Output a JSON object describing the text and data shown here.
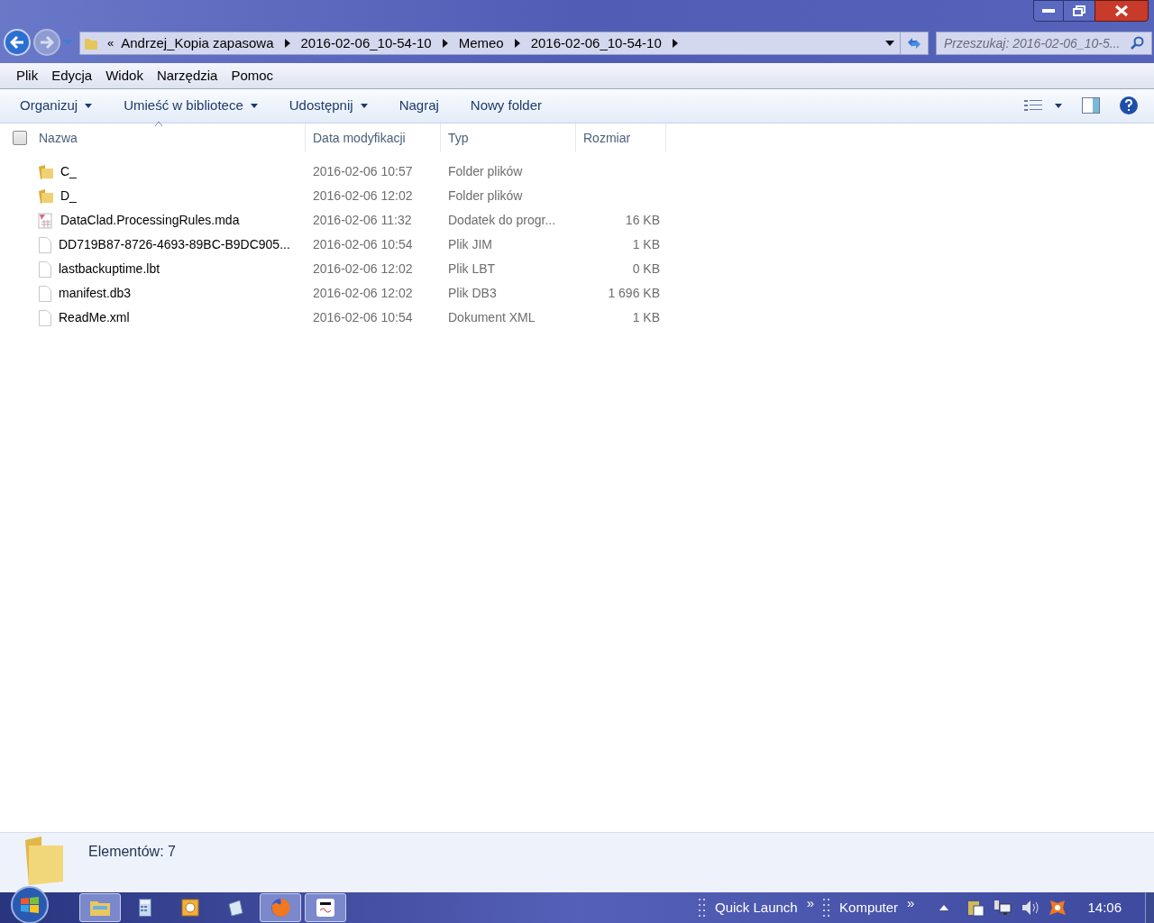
{
  "address_bar": {
    "overflow": "«",
    "segments": [
      "Andrzej_Kopia zapasowa",
      "2016-02-06_10-54-10",
      "Memeo",
      "2016-02-06_10-54-10"
    ]
  },
  "search": {
    "placeholder": "Przeszukaj: 2016-02-06_10-5..."
  },
  "menu": [
    "Plik",
    "Edycja",
    "Widok",
    "Narzędzia",
    "Pomoc"
  ],
  "toolbar": [
    {
      "label": "Organizuj",
      "dropdown": true
    },
    {
      "label": "Umieść w bibliotece",
      "dropdown": true
    },
    {
      "label": "Udostępnij",
      "dropdown": true
    },
    {
      "label": "Nagraj",
      "dropdown": false
    },
    {
      "label": "Nowy folder",
      "dropdown": false
    }
  ],
  "table": {
    "select_all": {
      "checked": false
    },
    "columns": [
      "Nazwa",
      "Data modyfikacji",
      "Typ",
      "Rozmiar"
    ],
    "rows": [
      {
        "kind": "folder",
        "name": "C_",
        "date": "2016-02-06 10:57",
        "type": "Folder plików",
        "size": ""
      },
      {
        "kind": "folder",
        "name": "D_",
        "date": "2016-02-06 12:02",
        "type": "Folder plików",
        "size": ""
      },
      {
        "kind": "addin",
        "name": "DataClad.ProcessingRules.mda",
        "date": "2016-02-06 11:32",
        "type": "Dodatek do progr...",
        "size": "16 KB"
      },
      {
        "kind": "file",
        "name": "DD719B87-8726-4693-89BC-B9DC905...",
        "date": "2016-02-06 10:54",
        "type": "Plik JIM",
        "size": "1 KB"
      },
      {
        "kind": "file",
        "name": "lastbackuptime.lbt",
        "date": "2016-02-06 12:02",
        "type": "Plik LBT",
        "size": "0 KB"
      },
      {
        "kind": "file",
        "name": "manifest.db3",
        "date": "2016-02-06 12:02",
        "type": "Plik DB3",
        "size": "1 696 KB"
      },
      {
        "kind": "file",
        "name": "ReadMe.xml",
        "date": "2016-02-06 10:54",
        "type": "Dokument XML",
        "size": "1 KB"
      }
    ]
  },
  "details_pane": {
    "count": "Elementów: 7"
  },
  "taskbar": {
    "apps": [
      {
        "kind": "explorer",
        "selected": true
      },
      {
        "kind": "calculator",
        "selected": false
      },
      {
        "kind": "outlook",
        "selected": false
      },
      {
        "kind": "notepad",
        "selected": false
      },
      {
        "kind": "firefox",
        "selected": true
      },
      {
        "kind": "bdm",
        "selected": true
      }
    ],
    "toolbars": [
      {
        "label": "Quick Launch",
        "more": "»"
      },
      {
        "label": "Komputer",
        "more": "»"
      }
    ],
    "clock": "14:06"
  }
}
